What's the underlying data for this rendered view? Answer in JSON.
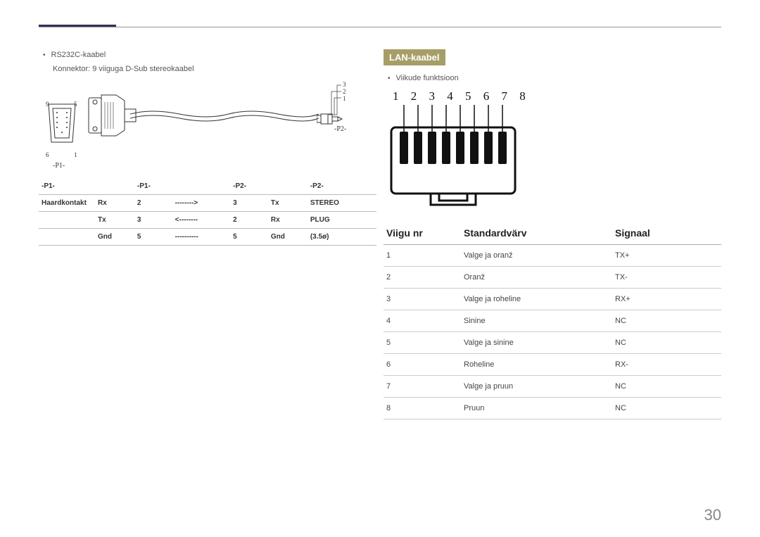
{
  "left": {
    "bullet": "RS232C-kaabel",
    "subline": "Konnektor: 9 viiguga D-Sub stereokaabel",
    "diagram": {
      "n9": "9",
      "n5": "5",
      "n6": "6",
      "n1": "1",
      "p1": "-P1-",
      "p2": "-P2-",
      "j3": "3",
      "j2": "2",
      "j1": "1"
    },
    "pin_hdr": [
      "-P1-",
      "-P1-",
      "-P2-",
      "-P2-"
    ],
    "first_col_label": "Haardkontakt",
    "rows": [
      [
        "Rx",
        "2",
        "-------->",
        "3",
        "Tx",
        "STEREO"
      ],
      [
        "Tx",
        "3",
        "<--------",
        "2",
        "Rx",
        "PLUG"
      ],
      [
        "Gnd",
        "5",
        "----------",
        "5",
        "Gnd",
        "(3.5ø)"
      ]
    ]
  },
  "right": {
    "heading": "LAN-kaabel",
    "bullet": "Viikude funktsioon",
    "nums": "1 2 3 4 5 6 7 8",
    "table_hdr": [
      "Viigu nr",
      "Standardvärv",
      "Signaal"
    ],
    "rows": [
      [
        "1",
        "Valge ja oranž",
        "TX+"
      ],
      [
        "2",
        "Oranž",
        "TX-"
      ],
      [
        "3",
        "Valge ja roheline",
        "RX+"
      ],
      [
        "4",
        "Sinine",
        "NC"
      ],
      [
        "5",
        "Valge ja sinine",
        "NC"
      ],
      [
        "6",
        "Roheline",
        "RX-"
      ],
      [
        "7",
        "Valge ja pruun",
        "NC"
      ],
      [
        "8",
        "Pruun",
        "NC"
      ]
    ]
  },
  "page_number": "30"
}
